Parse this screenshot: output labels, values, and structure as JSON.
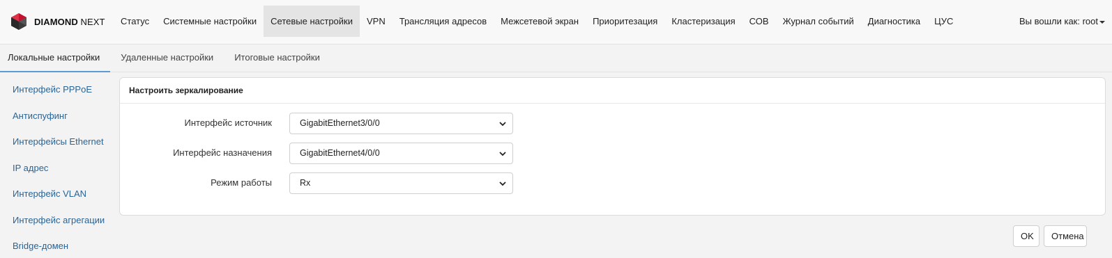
{
  "brand": {
    "name_bold": "DIAMOND",
    "name_rest": "NEXT"
  },
  "nav": {
    "items": [
      {
        "label": "Статус"
      },
      {
        "label": "Системные настройки"
      },
      {
        "label": "Сетевые настройки",
        "active": true
      },
      {
        "label": "VPN"
      },
      {
        "label": "Трансляция адресов"
      },
      {
        "label": "Межсетевой экран"
      },
      {
        "label": "Приоритезация"
      },
      {
        "label": "Кластеризация"
      },
      {
        "label": "СОВ"
      },
      {
        "label": "Журнал событий"
      },
      {
        "label": "Диагностика"
      },
      {
        "label": "ЦУС"
      }
    ],
    "user_label": "Вы вошли как: root"
  },
  "subtabs": [
    {
      "label": "Локальные настройки",
      "active": true
    },
    {
      "label": "Удаленные настройки"
    },
    {
      "label": "Итоговые настройки"
    }
  ],
  "sidebar": {
    "items": [
      {
        "label": "Интерфейс PPPoE"
      },
      {
        "label": "Антиспуфинг"
      },
      {
        "label": "Интерфейсы Ethernet"
      },
      {
        "label": "IP адрес"
      },
      {
        "label": "Интерфейс VLAN"
      },
      {
        "label": "Интерфейс агрегации"
      },
      {
        "label": "Bridge-домен"
      }
    ]
  },
  "panel": {
    "title": "Настроить зеркалирование",
    "fields": [
      {
        "label": "Интерфейс источник",
        "value": "GigabitEthernet3/0/0"
      },
      {
        "label": "Интерфейс назначения",
        "value": "GigabitEthernet4/0/0"
      },
      {
        "label": "Режим работы",
        "value": "Rx"
      }
    ]
  },
  "actions": {
    "ok_label": "OK",
    "cancel_label": "Отмена"
  },
  "colors": {
    "link": "#2a6496",
    "active_tab_underline": "#5a9bd5",
    "logo": "#c8102e"
  },
  "icons": {
    "logo": "diamond-logo-icon",
    "select_arrow": "chevron-down-icon",
    "user_caret": "caret-down-icon"
  }
}
